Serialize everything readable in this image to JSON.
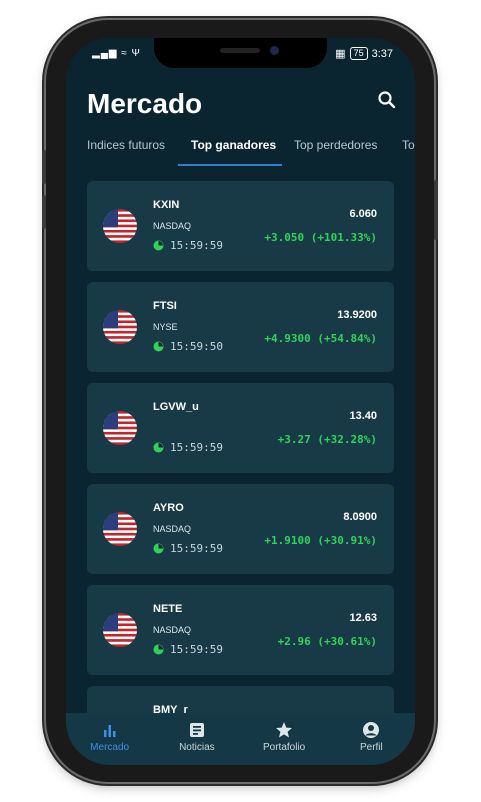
{
  "status_bar": {
    "time": "3:37",
    "battery": "75",
    "left_icons": "▂▄▆ ≈ Ψ"
  },
  "header": {
    "title": "Mercado",
    "search_icon": "search-icon"
  },
  "tabs": [
    {
      "label": "Indices futuros",
      "active": false
    },
    {
      "label": "Top ganadores",
      "active": true
    },
    {
      "label": "Top perdedores",
      "active": false
    },
    {
      "label": "To",
      "active": false
    }
  ],
  "stocks": [
    {
      "symbol": "KXIN",
      "exchange": "NASDAQ",
      "time": "15:59:59",
      "price": "6.060",
      "change": "+3.050 (+101.33%)"
    },
    {
      "symbol": "FTSI",
      "exchange": "NYSE",
      "time": "15:59:50",
      "price": "13.9200",
      "change": "+4.9300 (+54.84%)"
    },
    {
      "symbol": "LGVW_u",
      "exchange": "",
      "time": "15:59:59",
      "price": "13.40",
      "change": "+3.27 (+32.28%)"
    },
    {
      "symbol": "AYRO",
      "exchange": "NASDAQ",
      "time": "15:59:59",
      "price": "8.0900",
      "change": "+1.9100 (+30.91%)"
    },
    {
      "symbol": "NETE",
      "exchange": "NASDAQ",
      "time": "15:59:59",
      "price": "12.63",
      "change": "+2.96 (+30.61%)"
    },
    {
      "symbol": "BMY_r",
      "exchange": "",
      "time": "",
      "price": "",
      "change": ""
    }
  ],
  "bottom_nav": [
    {
      "label": "Mercado",
      "icon": "bar-chart-icon",
      "active": true
    },
    {
      "label": "Noticias",
      "icon": "news-icon",
      "active": false
    },
    {
      "label": "Portafolio",
      "icon": "star-icon",
      "active": false
    },
    {
      "label": "Perfil",
      "icon": "user-icon",
      "active": false
    }
  ],
  "colors": {
    "background": "#0b2530",
    "card": "#183a46",
    "positive": "#2fd35a",
    "accent": "#2e7dd8"
  }
}
